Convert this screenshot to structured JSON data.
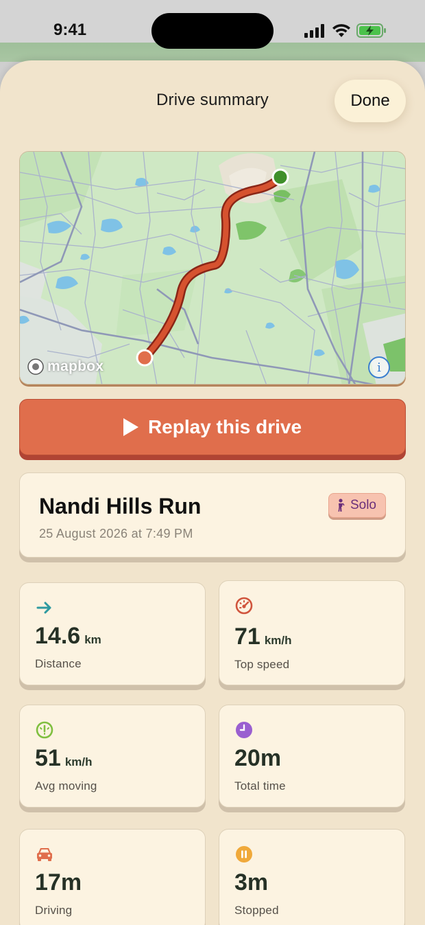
{
  "status": {
    "time": "9:41"
  },
  "header": {
    "title": "Drive summary",
    "done_label": "Done"
  },
  "map": {
    "attribution": "mapbox",
    "info_label": "i"
  },
  "replay": {
    "label": "Replay this drive"
  },
  "drive": {
    "name": "Nandi Hills Run",
    "date": "25 August 2026 at 7:49 PM",
    "badge": "Solo"
  },
  "stats": [
    {
      "icon": "arrow-right-icon",
      "value": "14.6",
      "unit": "km",
      "label": "Distance",
      "color": "#2e9aa0"
    },
    {
      "icon": "speedometer-icon",
      "value": "71",
      "unit": "km/h",
      "label": "Top speed",
      "color": "#d0543c"
    },
    {
      "icon": "gauge-icon",
      "value": "51",
      "unit": "km/h",
      "label": "Avg moving",
      "color": "#7fbf3f"
    },
    {
      "icon": "clock-icon",
      "value": "20m",
      "unit": "",
      "label": "Total time",
      "color": "#9a5fd0"
    },
    {
      "icon": "car-icon",
      "value": "17m",
      "unit": "",
      "label": "Driving",
      "color": "#e06e4c"
    },
    {
      "icon": "pause-icon",
      "value": "3m",
      "unit": "",
      "label": "Stopped",
      "color": "#f0a93a"
    }
  ],
  "colors": {
    "accent": "#e06e4c",
    "sheet": "#f1e4cc",
    "card": "#fcf3e1",
    "route": "#d6522f",
    "start": "#3f8f2a"
  }
}
